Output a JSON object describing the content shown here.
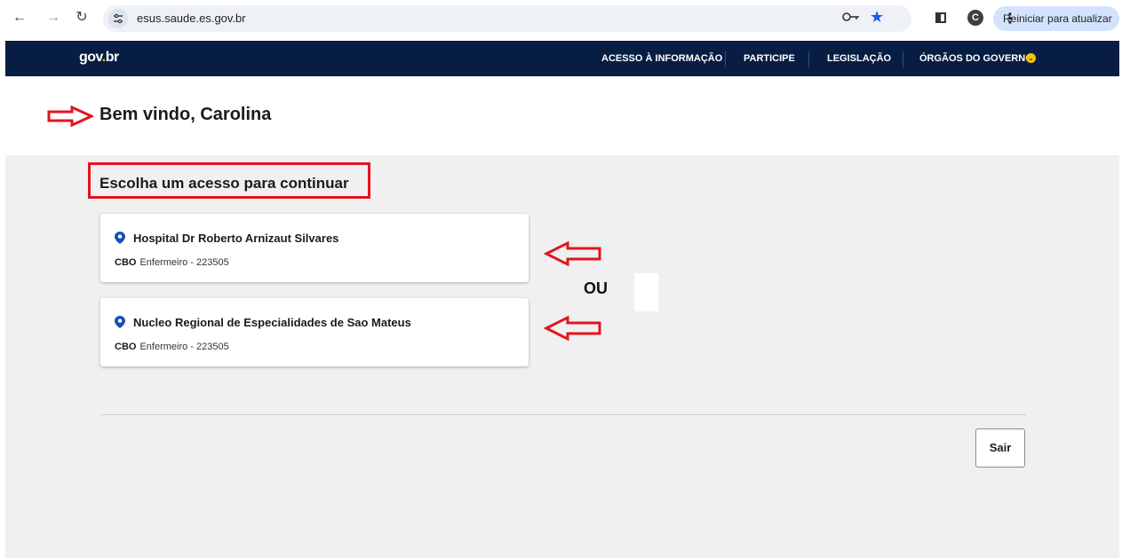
{
  "browser": {
    "back_icon": "back-arrow-icon",
    "forward_icon": "forward-arrow-icon",
    "reload_icon": "reload-icon",
    "url": "esus.saude.es.gov.br",
    "profile_initial": "C",
    "update_button_label": "Reiniciar para atualizar"
  },
  "gov_header": {
    "logo": "gov.br",
    "links": [
      "ACESSO À INFORMAÇÃO",
      "PARTICIPE",
      "LEGISLAÇÃO",
      "ÓRGÃOS DO GOVERNO"
    ],
    "background_color": "#071d41"
  },
  "welcome": {
    "title": "Bem vindo, Carolina"
  },
  "main": {
    "heading": "Escolha um acesso para continuar",
    "cards": [
      {
        "unit": "Hospital Dr Roberto Arnizaut Silvares",
        "cbo_label": "CBO",
        "cbo_value": "Enfermeiro - 223505"
      },
      {
        "unit": "Nucleo Regional de Especialidades de Sao Mateus",
        "cbo_label": "CBO",
        "cbo_value": "Enfermeiro - 223505"
      }
    ],
    "or_label": "OU",
    "exit_button": "Sair"
  },
  "colors": {
    "annotation_red": "#e3141f",
    "pin_blue": "#1351b4"
  }
}
